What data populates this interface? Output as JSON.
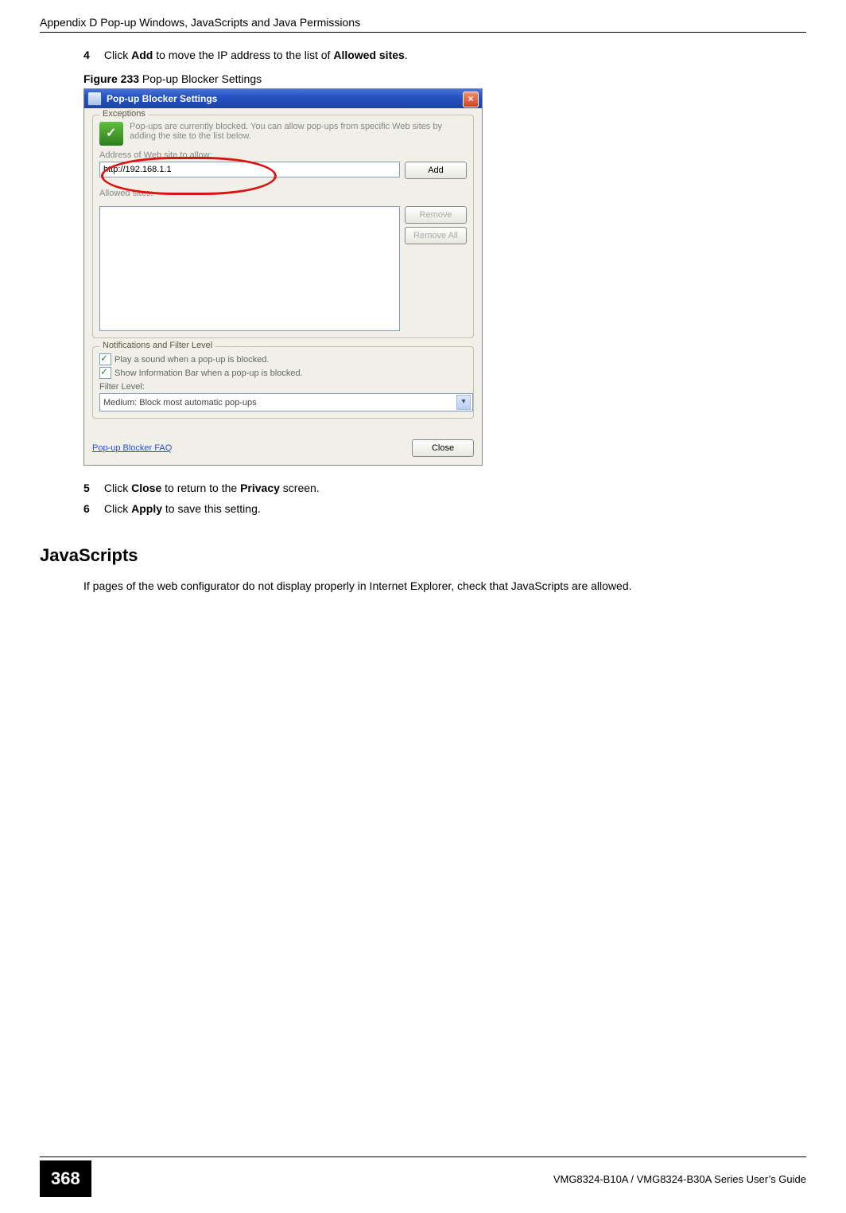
{
  "header": {
    "left": "Appendix D Pop-up Windows, JavaScripts and Java Permissions"
  },
  "step4": {
    "num": "4",
    "pre": "Click ",
    "b1": "Add",
    "mid": " to move the IP address to the list of ",
    "b2": "Allowed sites",
    "post": "."
  },
  "figure_caption": {
    "label": "Figure 233",
    "text": "   Pop-up Blocker Settings"
  },
  "dialog": {
    "title": "Pop-up Blocker Settings",
    "group_exceptions": "Exceptions",
    "info_text": "Pop-ups are currently blocked. You can allow pop-ups from specific Web sites by adding the site to the list below.",
    "address_label": "Address of Web site to allow:",
    "url_value": "http://192.168.1.1",
    "add_btn": "Add",
    "allowed_label": "Allowed sites:",
    "remove_btn": "Remove",
    "removeall_btn": "Remove All",
    "group_notif": "Notifications and Filter Level",
    "cb_sound": "Play a sound when a pop-up is blocked.",
    "cb_infobar": "Show Information Bar when a pop-up is blocked.",
    "filter_label": "Filter Level:",
    "filter_value": "Medium: Block most automatic pop-ups",
    "faq": "Pop-up Blocker FAQ",
    "close_btn": "Close"
  },
  "step5": {
    "num": "5",
    "pre": "Click ",
    "b1": "Close",
    "mid": " to return to the ",
    "b2": "Privacy",
    "post": " screen."
  },
  "step6": {
    "num": "6",
    "pre": "Click ",
    "b1": "Apply",
    "post": " to save this setting."
  },
  "section_heading": "JavaScripts",
  "section_para": "If pages of the web configurator do not display properly in Internet Explorer, check that JavaScripts are allowed.",
  "footer": {
    "page": "368",
    "right": "VMG8324-B10A / VMG8324-B30A Series User’s Guide"
  }
}
